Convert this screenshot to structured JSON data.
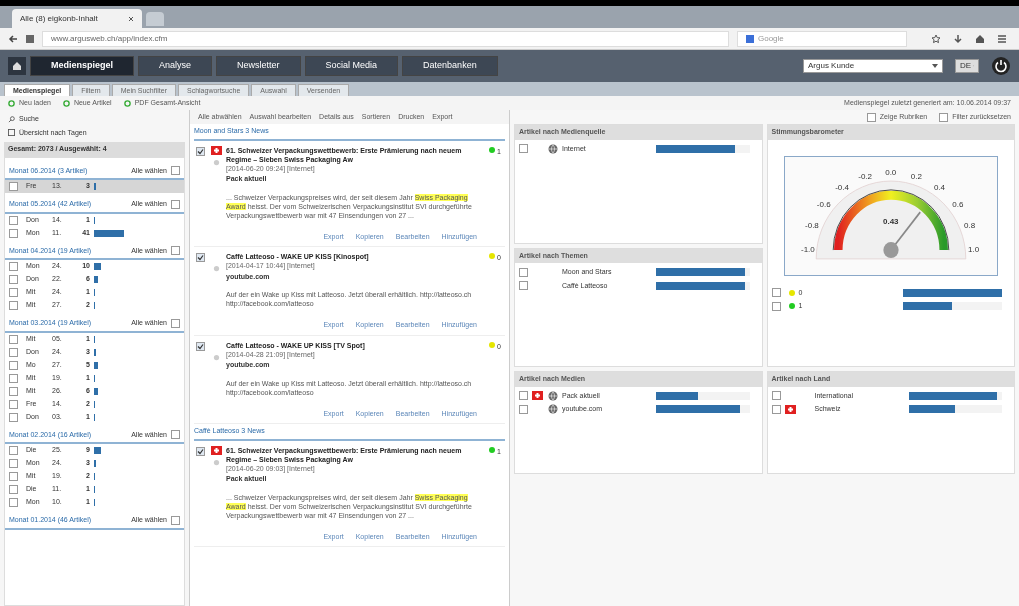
{
  "browser": {
    "tab_title": "Alle (8) eigkonb-Inhalt",
    "url": "www.argusweb.ch/app/index.cfm",
    "search_placeholder": "Google"
  },
  "nav": [
    {
      "label": "Medienspiegel",
      "selected": true
    },
    {
      "label": "Analyse",
      "selected": false
    },
    {
      "label": "Newsletter",
      "selected": false
    },
    {
      "label": "Social Media",
      "selected": false
    },
    {
      "label": "Datenbanken",
      "selected": false
    }
  ],
  "account_select": "Argus Kunde",
  "language_select": "DE",
  "subtabs": [
    {
      "label": "Medienspiegel",
      "selected": true
    },
    {
      "label": "Filtern",
      "selected": false
    },
    {
      "label": "Mein Suchfilter",
      "selected": false
    },
    {
      "label": "Schlagwortsuche",
      "selected": false
    },
    {
      "label": "Auswahl",
      "selected": false
    },
    {
      "label": "Versenden",
      "selected": false
    }
  ],
  "toolbar": [
    "Neu laden",
    "Neue Artikel",
    "PDF Gesamt-Ansicht"
  ],
  "generated_note": "Medienspiegel zuletzt generiert am: 10.06.2014 09:37",
  "sidebar": {
    "search": "Suche",
    "overview": "Übersicht nach Tagen",
    "total": "Gesamt: 2073 / Ausgewählt: 4",
    "months": [
      {
        "title": "Monat 06.2014 (3 Artikel)",
        "select_all": "Alle wählen",
        "checked": false,
        "days": [
          {
            "day": "Fre",
            "date": "13.",
            "count": "3",
            "selected": true,
            "checked": false
          }
        ]
      },
      {
        "title": "Monat 05.2014 (42 Artikel)",
        "select_all": "Alle wählen",
        "checked": false,
        "days": [
          {
            "day": "Don",
            "date": "14.",
            "count": "1",
            "selected": false,
            "checked": false
          },
          {
            "day": "Mon",
            "date": "11.",
            "count": "41",
            "selected": false,
            "checked": false
          }
        ]
      },
      {
        "title": "Monat 04.2014 (19 Artikel)",
        "select_all": "Alle wählen",
        "checked": false,
        "days": [
          {
            "day": "Mon",
            "date": "24.",
            "count": "10",
            "selected": false,
            "checked": false
          },
          {
            "day": "Don",
            "date": "22.",
            "count": "6",
            "selected": false,
            "checked": false
          },
          {
            "day": "Mit",
            "date": "24.",
            "count": "1",
            "selected": false,
            "checked": false
          },
          {
            "day": "Mit",
            "date": "27.",
            "count": "2",
            "selected": false,
            "checked": false
          }
        ]
      },
      {
        "title": "Monat 03.2014 (19 Artikel)",
        "select_all": "Alle wählen",
        "checked": false,
        "days": [
          {
            "day": "Mit",
            "date": "05.",
            "count": "1",
            "selected": false,
            "checked": false
          },
          {
            "day": "Don",
            "date": "24.",
            "count": "3",
            "selected": false,
            "checked": false
          },
          {
            "day": "Mo",
            "date": "27.",
            "count": "5",
            "selected": false,
            "checked": false
          },
          {
            "day": "Mit",
            "date": "19.",
            "count": "1",
            "selected": false,
            "checked": false
          },
          {
            "day": "Mit",
            "date": "26.",
            "count": "6",
            "selected": false,
            "checked": false
          },
          {
            "day": "Fre",
            "date": "14.",
            "count": "2",
            "selected": false,
            "checked": false
          },
          {
            "day": "Don",
            "date": "03.",
            "count": "1",
            "selected": false,
            "checked": false
          }
        ]
      },
      {
        "title": "Monat 02.2014 (16 Artikel)",
        "select_all": "Alle wählen",
        "checked": false,
        "days": [
          {
            "day": "Die",
            "date": "25.",
            "count": "9",
            "selected": false,
            "checked": false
          },
          {
            "day": "Mon",
            "date": "24.",
            "count": "3",
            "selected": false,
            "checked": false
          },
          {
            "day": "Mit",
            "date": "19.",
            "count": "2",
            "selected": false,
            "checked": false
          },
          {
            "day": "Die",
            "date": "11.",
            "count": "1",
            "selected": false,
            "checked": false
          },
          {
            "day": "Mon",
            "date": "10.",
            "count": "1",
            "selected": false,
            "checked": false
          }
        ]
      },
      {
        "title": "Monat 01.2014 (46 Artikel)",
        "select_all": "Alle wählen",
        "checked": false
      }
    ]
  },
  "list_toolbar": [
    "Alle abwählen",
    "Auswahl bearbeiten",
    "Details aus",
    "Sortieren",
    "Drucken",
    "Export"
  ],
  "list_options": [
    {
      "label": "Zeige Rubriken",
      "checked": false
    },
    {
      "label": "Filter zurücksetzen",
      "checked": false
    }
  ],
  "groups": [
    {
      "title": "Moon and Stars 3 News",
      "articles": [
        {
          "checked": true,
          "flag": true,
          "title": "61. Schweizer Verpackungswettbewerb: Erste Prämierung nach neuem Regime – Sieben Swiss Packaging Aw",
          "meta": "[2014-06-20 09:24] [Internet]",
          "source": "Pack aktuell",
          "snippet": "... Schweizer Verpackungspreises wird, der seit diesem Jahr **Swiss Packaging Award** heisst. Der vom Schweizerischen Verpackungsinstitut SVI durchgeführte Verpackungswettbewerb war mit 47 Einsendungen von 27 ...",
          "rating": "1",
          "color": "#22cc22",
          "actions": [
            "Export",
            "Kopieren",
            "Bearbeiten",
            "Hinzufügen"
          ]
        },
        {
          "checked": true,
          "flag": false,
          "title": "Caffè Latteoso - WAKE UP KISS [Kinospot]",
          "meta": "[2014-04-17 10:44] [Internet]",
          "source": "youtube.com",
          "snippet": "Auf der ein Wake up Kiss mit Latteoso. Jetzt überall erhältlich. http://latteoso.ch http://facebook.com/latteoso",
          "rating": "0",
          "color": "#e6e600",
          "actions": [
            "Export",
            "Kopieren",
            "Bearbeiten",
            "Hinzufügen"
          ]
        },
        {
          "checked": true,
          "flag": false,
          "title": "Caffè Latteoso - WAKE UP KISS [TV Spot]",
          "meta": "[2014-04-28 21:09] [Internet]",
          "source": "youtube.com",
          "snippet": "Auf der ein Wake up Kiss mit Latteoso. Jetzt überall erhältlich. http://latteoso.ch http://facebook.com/latteoso",
          "rating": "0",
          "color": "#e6e600",
          "actions": [
            "Export",
            "Kopieren",
            "Bearbeiten",
            "Hinzufügen"
          ]
        }
      ]
    },
    {
      "title": "Caffè Latteoso 3 News",
      "articles": [
        {
          "checked": true,
          "flag": true,
          "title": "61. Schweizer Verpackungswettbewerb: Erste Prämierung nach neuem Regime – Sieben Swiss Packaging Aw",
          "meta": "[2014-06-20 09:03] [Internet]",
          "source": "Pack aktuell",
          "snippet": "... Schweizer Verpackungspreises wird, der seit diesem Jahr **Swiss Packaging Award** heisst. Der vom Schweizerischen Verpackungsinstitut SVI durchgeführte Verpackungswettbewerb war mit 47 Einsendungen von 27 ...",
          "rating": "1",
          "color": "#22cc22",
          "actions": [
            "Export",
            "Kopieren",
            "Bearbeiten",
            "Hinzufügen"
          ]
        }
      ]
    }
  ],
  "panels": [
    {
      "title": "Artikel nach Medienquelle",
      "items": [
        {
          "label": "Internet",
          "checked": false,
          "flag": false,
          "globe": true,
          "level": 0.85
        }
      ]
    },
    {
      "title": "Artikel nach Themen",
      "items": [
        {
          "label": "Moon and Stars",
          "checked": false,
          "flag": false,
          "globe": false,
          "level": 0.95
        },
        {
          "label": "Caffè Latteoso",
          "checked": false,
          "flag": false,
          "globe": false,
          "level": 0.95
        }
      ]
    },
    {
      "title": "Artikel nach Medien",
      "items": [
        {
          "label": "Pack aktuell",
          "checked": false,
          "flag": true,
          "globe": true,
          "level": 0.45
        },
        {
          "label": "youtube.com",
          "checked": false,
          "flag": false,
          "globe": true,
          "level": 0.9
        }
      ]
    },
    {
      "title": "Artikel nach Land",
      "items": [
        {
          "label": "International",
          "checked": false,
          "flag": false,
          "globe": false,
          "level": 0.95
        },
        {
          "label": "Schweiz",
          "checked": false,
          "flag": true,
          "globe": false,
          "level": 0.5
        }
      ]
    }
  ],
  "gauge": {
    "title": "Stimmungsbarometer",
    "ticks": [
      "-1.0",
      "-0.8",
      "-0.6",
      "-0.4",
      "-0.2",
      "0.0",
      "0.2",
      "0.4",
      "0.6",
      "0.8",
      "1.0"
    ],
    "reading": "0.43",
    "level": 0.715,
    "legend": [
      {
        "label": "0",
        "checked": false,
        "color": "#e6e600",
        "level": 1
      },
      {
        "label": "1",
        "checked": false,
        "color": "#22cc22",
        "level": 0.5
      }
    ]
  }
}
